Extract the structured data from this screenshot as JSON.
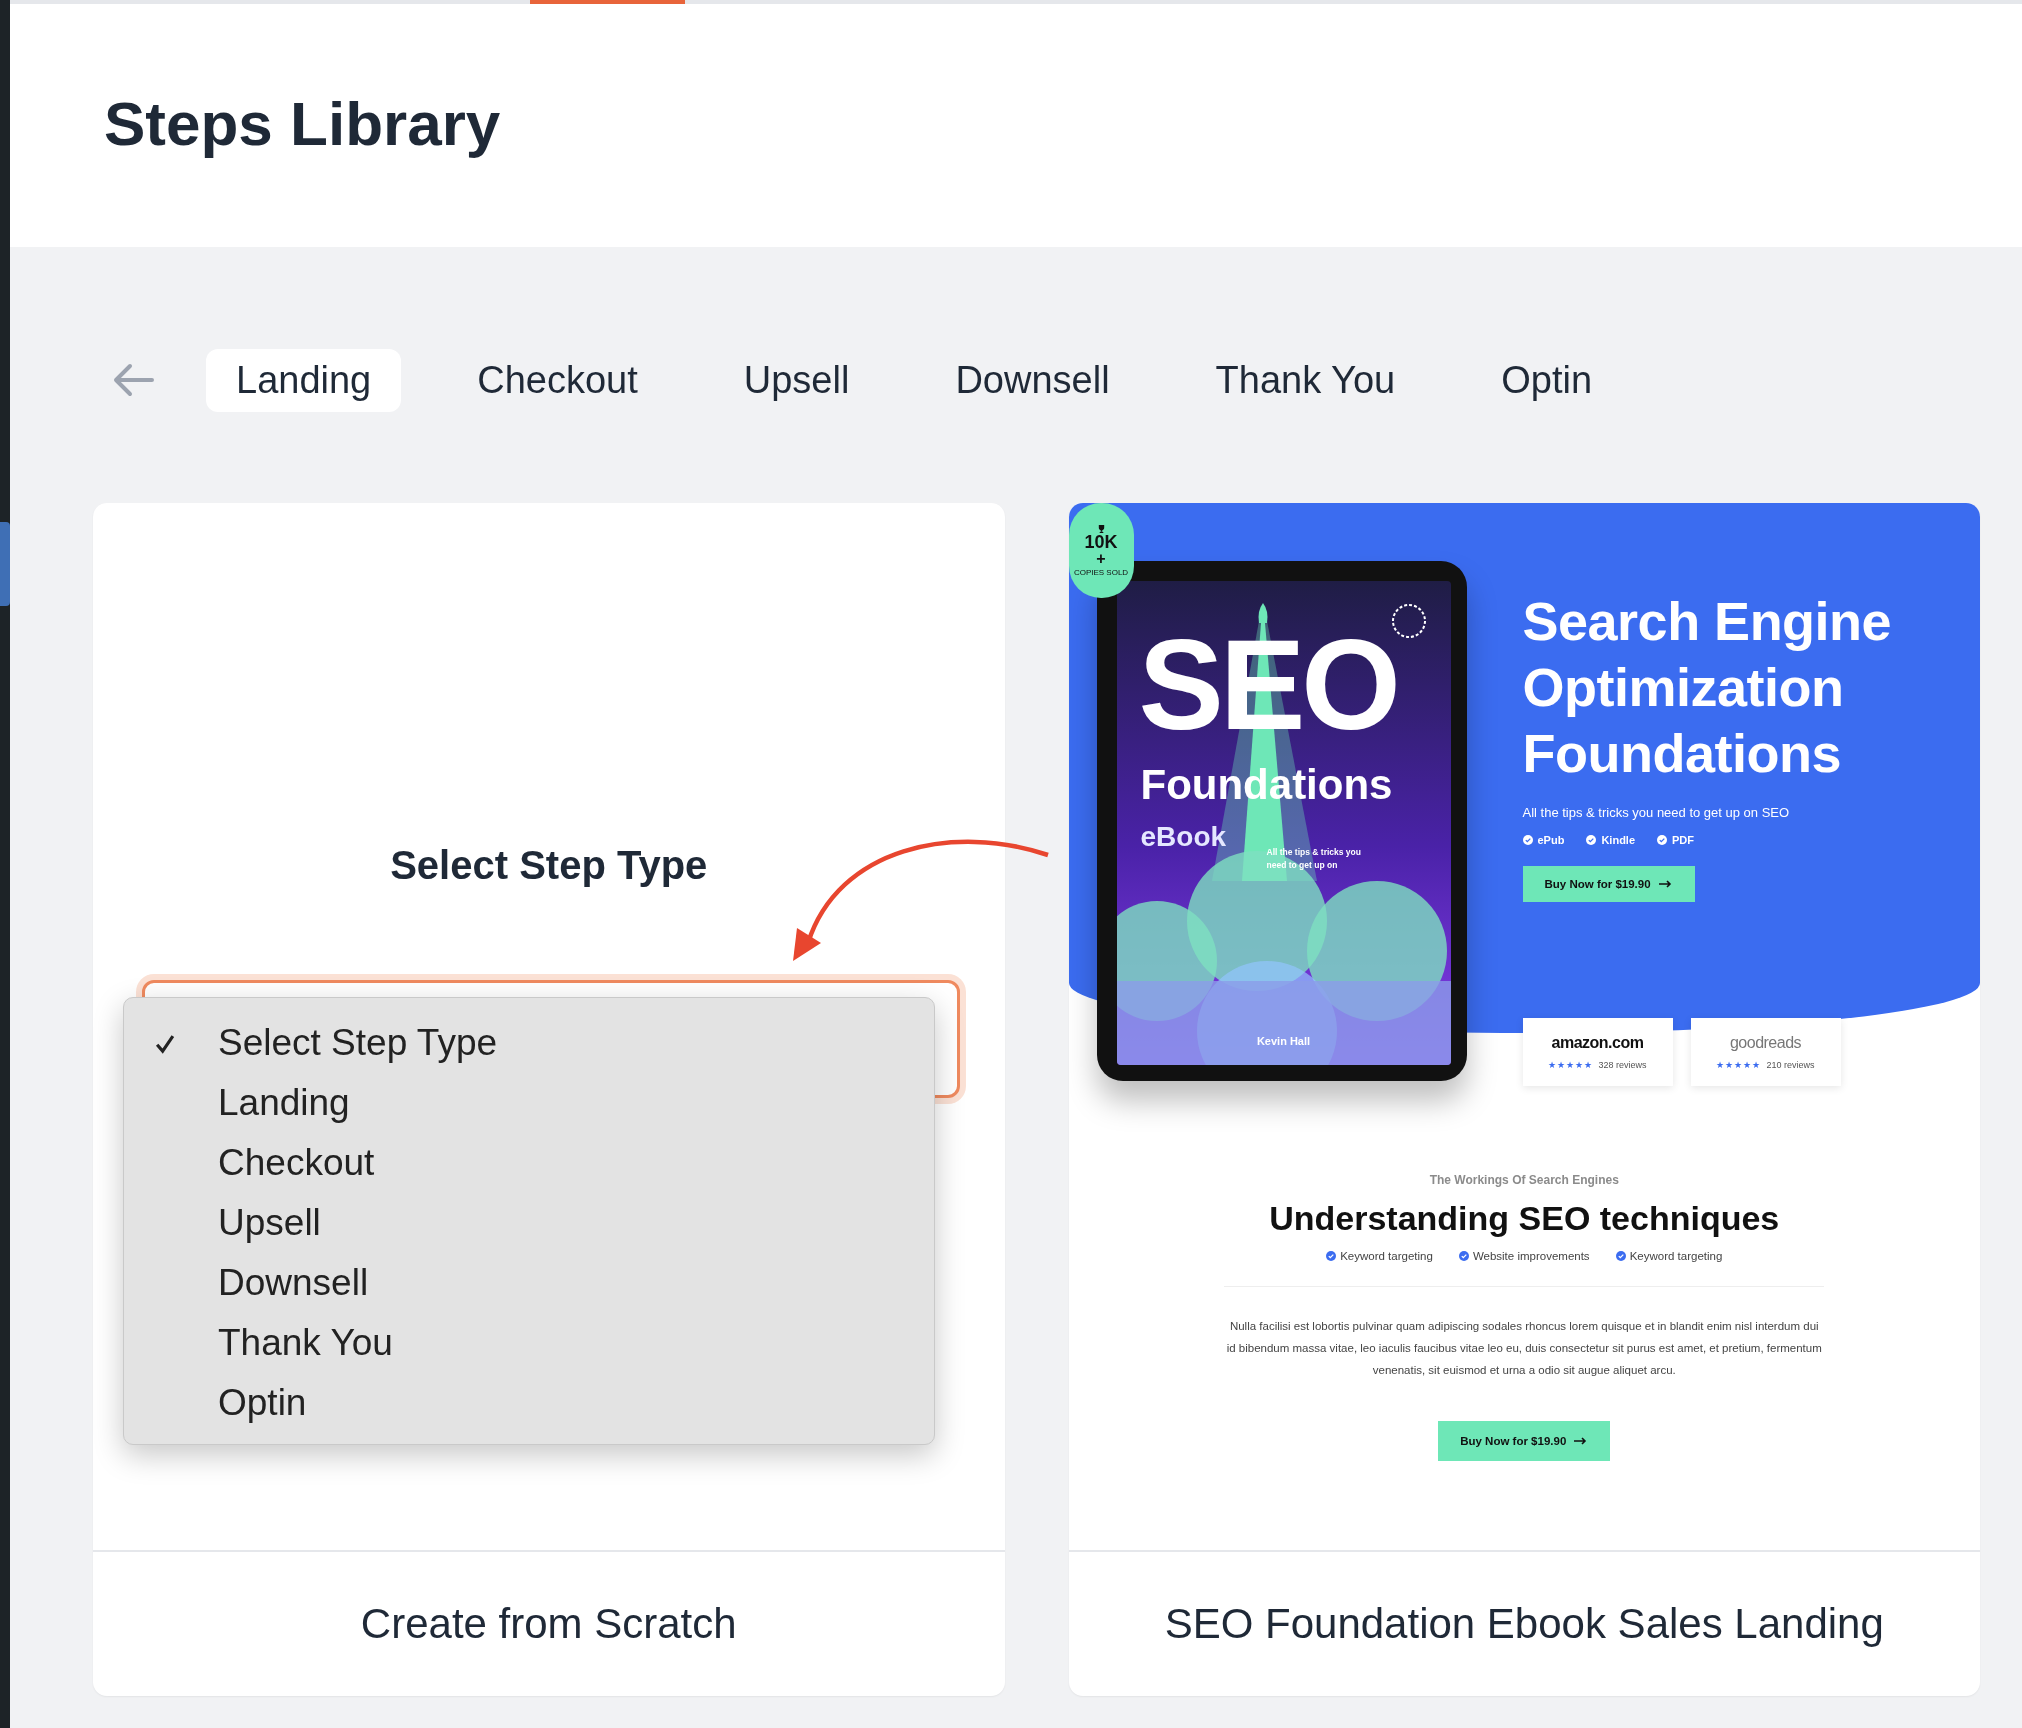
{
  "page_title": "Steps Library",
  "tabs": [
    {
      "label": "Landing",
      "selected": true
    },
    {
      "label": "Checkout",
      "selected": false
    },
    {
      "label": "Upsell",
      "selected": false
    },
    {
      "label": "Downsell",
      "selected": false
    },
    {
      "label": "Thank You",
      "selected": false
    },
    {
      "label": "Optin",
      "selected": false
    }
  ],
  "cards": [
    {
      "kind": "scratch",
      "prompt": "Select Step Type",
      "options": [
        {
          "label": "Select Step Type",
          "selected": true
        },
        {
          "label": "Landing",
          "selected": false
        },
        {
          "label": "Checkout",
          "selected": false
        },
        {
          "label": "Upsell",
          "selected": false
        },
        {
          "label": "Downsell",
          "selected": false
        },
        {
          "label": "Thank You",
          "selected": false
        },
        {
          "label": "Optin",
          "selected": false
        }
      ],
      "title": "Create from Scratch"
    },
    {
      "kind": "template",
      "title": "SEO Foundation Ebook Sales Landing",
      "preview": {
        "badge": {
          "count": "10K",
          "plus": "+",
          "caption": "COPIES SOLD"
        },
        "cover": {
          "title": "SEO",
          "subtitle": "Foundations",
          "format": "eBook",
          "tagline": "All the tips & tricks you need to get up on",
          "author": "Kevin Hall"
        },
        "hero": {
          "heading": "Search Engine Optimization Foundations",
          "lead": "All the tips & tricks you need to get up on SEO",
          "formats": [
            "ePub",
            "Kindle",
            "PDF"
          ],
          "button": "Buy Now for $19.90"
        },
        "reviews": [
          {
            "source": "amazon.com",
            "stars": 5,
            "count": "328 reviews"
          },
          {
            "source": "goodreads",
            "stars": 5,
            "count": "210 reviews"
          }
        ],
        "section": {
          "eyebrow": "The Workings Of Search Engines",
          "heading": "Understanding SEO techniques",
          "features": [
            "Keyword targeting",
            "Website improvements",
            "Keyword targeting"
          ],
          "body": "Nulla facilisi est lobortis pulvinar quam adipiscing sodales rhoncus lorem quisque et in blandit enim nisl interdum dui id bibendum massa vitae, leo iaculis faucibus vitae leo eu, duis consectetur sit purus est amet, et pretium, fermentum venenatis, sit euismod et urna a odio sit augue aliquet arcu.",
          "button": "Buy Now for $19.90"
        }
      }
    }
  ]
}
